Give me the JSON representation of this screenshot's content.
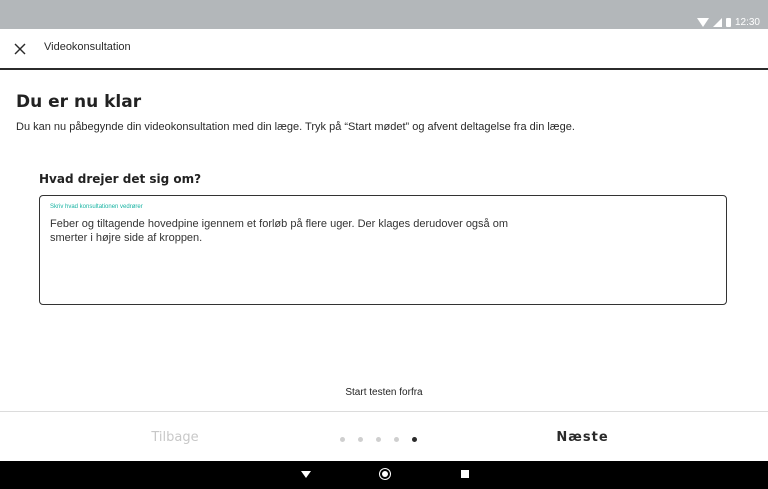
{
  "status_bar": {
    "time": "12:30"
  },
  "app_bar": {
    "title": "Videokonsultation",
    "close_icon": "close-icon"
  },
  "content": {
    "title": "Du er nu klar",
    "intro": "Du kan nu påbegynde din videokonsultation med din læge. Tryk på “Start mødet” og afvent deltagelse fra din læge.",
    "question": "Hvad drejer det sig om?",
    "field_label": "Skriv hvad konsultationen vedrører",
    "field_value": "Feber og tiltagende hovedpine igennem et forløb på flere uger. Der klages derudover også om smerter i højre side af kroppen."
  },
  "test_link": "Start testen forfra",
  "footer": {
    "back_label": "Tilbage",
    "next_label": "Næste",
    "pagination": {
      "total": 5,
      "active": 5
    }
  },
  "nav_bar": {
    "back_icon": "back-triangle-icon",
    "home_icon": "home-circle-icon",
    "recent_icon": "recent-square-icon"
  },
  "colors": {
    "accent": "#17b3a2",
    "status_bar": "#b3b7ba"
  }
}
